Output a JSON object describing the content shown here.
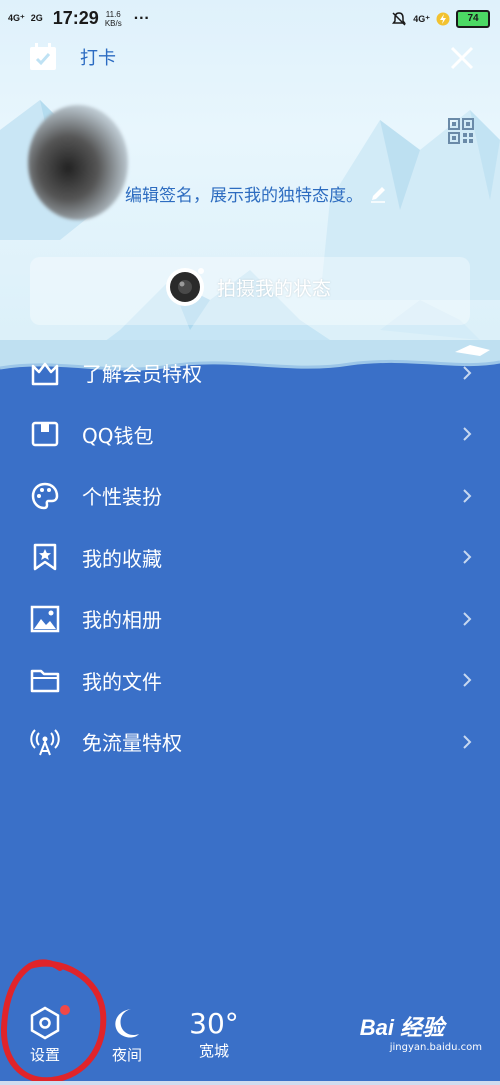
{
  "status_bar": {
    "signal1": "4G⁺",
    "signal2": "2G",
    "time": "17:29",
    "speed_value": "11.6",
    "speed_unit": "KB/s",
    "dots": "···",
    "network_right": "4G⁺",
    "battery": "74"
  },
  "header": {
    "punch_label": "打卡"
  },
  "profile": {
    "signature": "编辑签名，展示我的独特态度。"
  },
  "status_button": {
    "label": "拍摄我的状态"
  },
  "menu": {
    "items": [
      {
        "label": "了解会员特权",
        "icon": "vip-crown-icon"
      },
      {
        "label": "QQ钱包",
        "icon": "wallet-icon"
      },
      {
        "label": "个性装扮",
        "icon": "palette-icon"
      },
      {
        "label": "我的收藏",
        "icon": "bookmark-star-icon"
      },
      {
        "label": "我的相册",
        "icon": "image-icon"
      },
      {
        "label": "我的文件",
        "icon": "folder-icon"
      },
      {
        "label": "免流量特权",
        "icon": "antenna-icon"
      }
    ]
  },
  "toolbar": {
    "settings_label": "设置",
    "night_label": "夜间",
    "temperature": "30°",
    "city": "宽城"
  },
  "watermark": {
    "main": "Bai 经验",
    "sub": "jingyan.baidu.com"
  },
  "colors": {
    "menu_background": "#3a70c8",
    "accent_blue": "#2b6bc2",
    "notification_dot": "#f04848",
    "annotation_red": "#e0242a"
  }
}
